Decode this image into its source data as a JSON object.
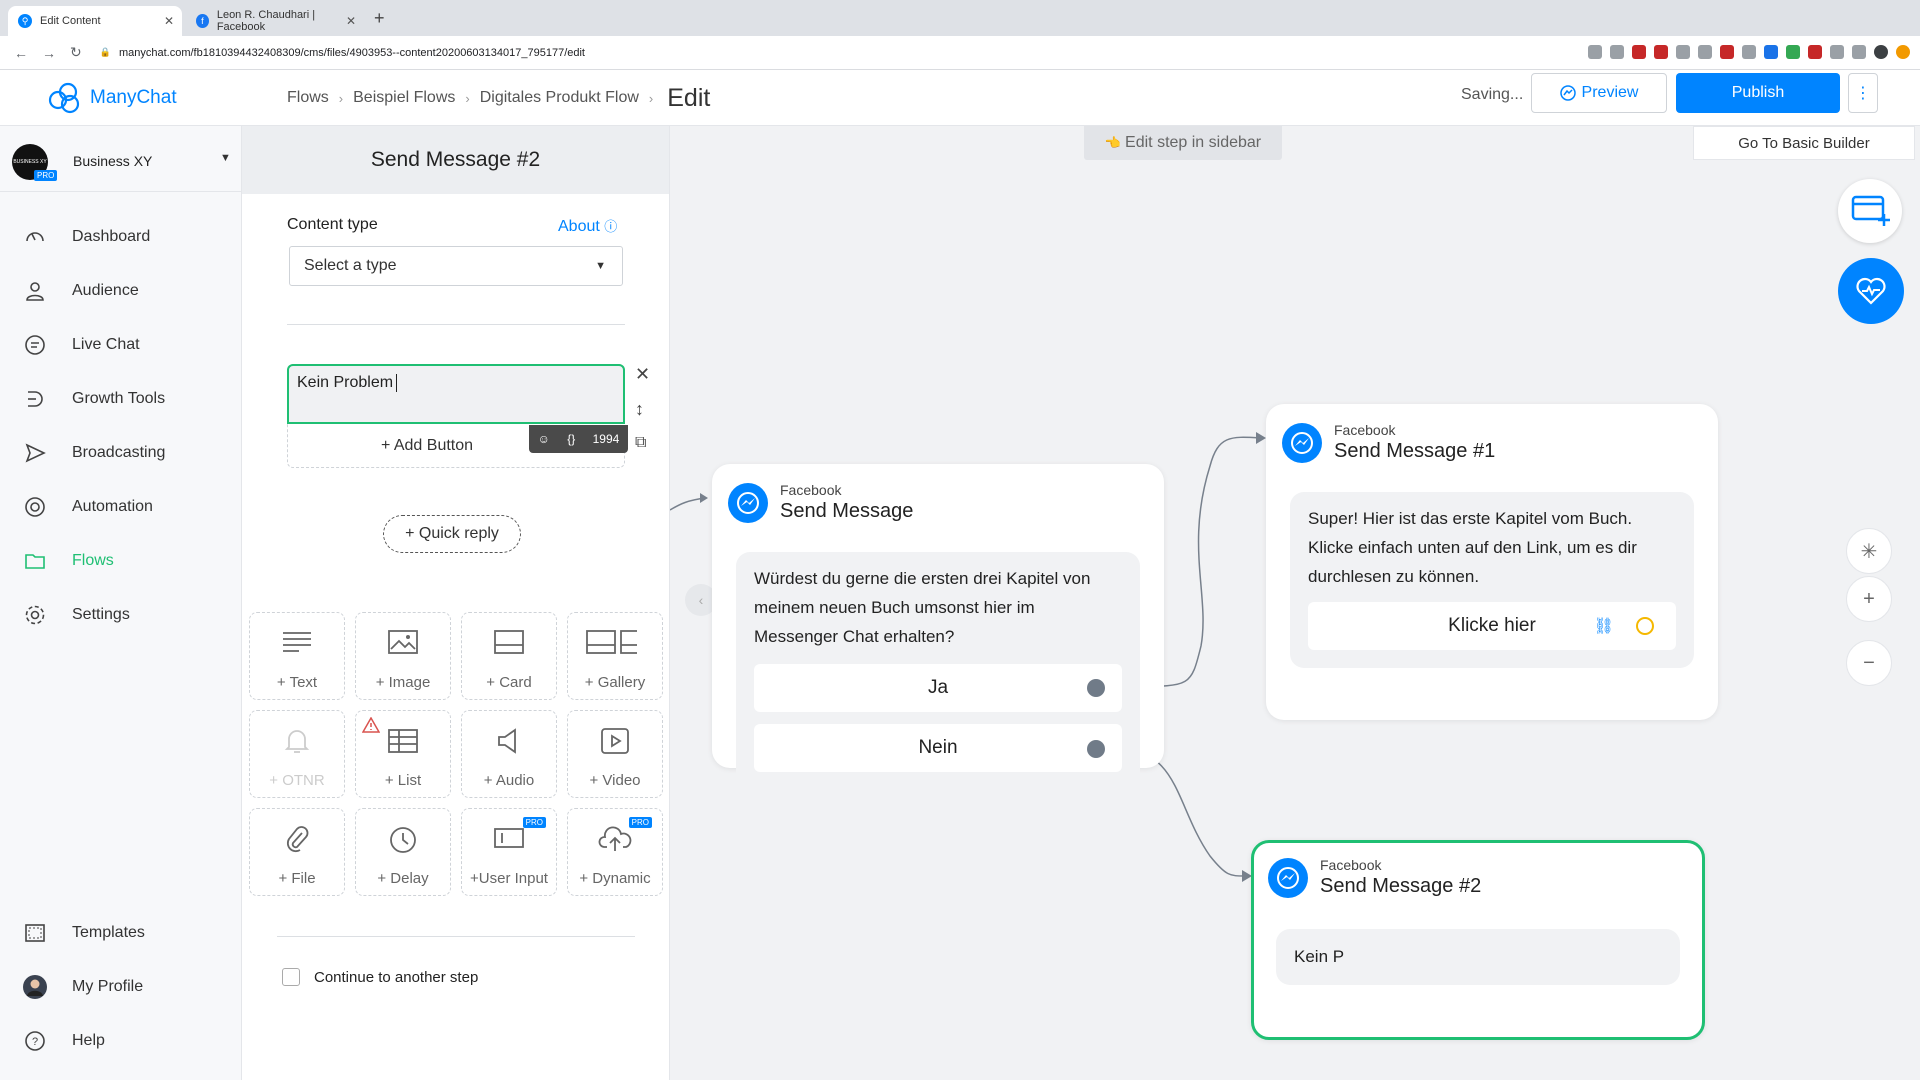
{
  "browser": {
    "tabs": [
      {
        "label": "Edit Content",
        "active": true
      },
      {
        "label": "Leon R. Chaudhari | Facebook",
        "active": false
      }
    ],
    "url": "manychat.com/fb181039443240830​9/cms/files/4903953--content20200603134017_795177/edit"
  },
  "header": {
    "logo_text": "ManyChat",
    "breadcrumb": [
      "Flows",
      "Beispiel Flows",
      "Digitales Produkt Flow"
    ],
    "current": "Edit",
    "status": "Saving...",
    "preview_label": "Preview",
    "publish_label": "Publish",
    "more_label": "⋮"
  },
  "account": {
    "name": "Business XY",
    "avatar_text": "BUSINESS XY",
    "badge": "PRO"
  },
  "nav": {
    "items": [
      {
        "label": "Dashboard",
        "icon": "dashboard-icon"
      },
      {
        "label": "Audience",
        "icon": "user-icon"
      },
      {
        "label": "Live Chat",
        "icon": "chat-icon"
      },
      {
        "label": "Growth Tools",
        "icon": "growth-icon"
      },
      {
        "label": "Broadcasting",
        "icon": "send-icon"
      },
      {
        "label": "Automation",
        "icon": "automation-icon"
      },
      {
        "label": "Flows",
        "icon": "folder-icon",
        "active": true
      },
      {
        "label": "Settings",
        "icon": "gear-icon"
      }
    ],
    "bottom": [
      {
        "label": "Templates",
        "icon": "templates-icon"
      },
      {
        "label": "My Profile",
        "icon": "avatar"
      },
      {
        "label": "Help",
        "icon": "help-icon"
      }
    ]
  },
  "editor": {
    "title": "Send Message #2",
    "content_type_label": "Content type",
    "about_label": "About",
    "select_value": "Select a type",
    "text_value": "Kein Problem",
    "char_count": "1994",
    "vars_label": "{}",
    "add_button_label": "+ Add Button",
    "quick_reply_label": "+ Quick reply",
    "tiles": [
      {
        "label": "+ Text"
      },
      {
        "label": "+ Image"
      },
      {
        "label": "+ Card"
      },
      {
        "label": "+ Gallery"
      },
      {
        "label": "+ OTNR"
      },
      {
        "label": "+ List"
      },
      {
        "label": "+ Audio"
      },
      {
        "label": "+ Video"
      },
      {
        "label": "+ File"
      },
      {
        "label": "+ Delay"
      },
      {
        "label": "+User Input"
      },
      {
        "label": "+ Dynamic"
      }
    ],
    "pro_badge": "PRO",
    "continue_label": "Continue to another step"
  },
  "canvas": {
    "hint": "Edit step in sidebar",
    "hint_icon": "👈",
    "go_basic": "Go To Basic Builder",
    "nodes": {
      "main": {
        "platform": "Facebook",
        "title": "Send Message",
        "text": "Würdest du gerne die ersten drei Kapitel von meinem neuen Buch umsonst hier im Messenger Chat erhalten?",
        "buttons": [
          "Ja",
          "Nein"
        ]
      },
      "msg1": {
        "platform": "Facebook",
        "title": "Send Message #1",
        "text": "Super! Hier ist das erste Kapitel vom Buch. Klicke einfach unten auf den Link, um es dir durchlesen zu können.",
        "button": "Klicke hier"
      },
      "msg2": {
        "platform": "Facebook",
        "title": "Send Message #2",
        "text": "Kein P"
      }
    }
  }
}
